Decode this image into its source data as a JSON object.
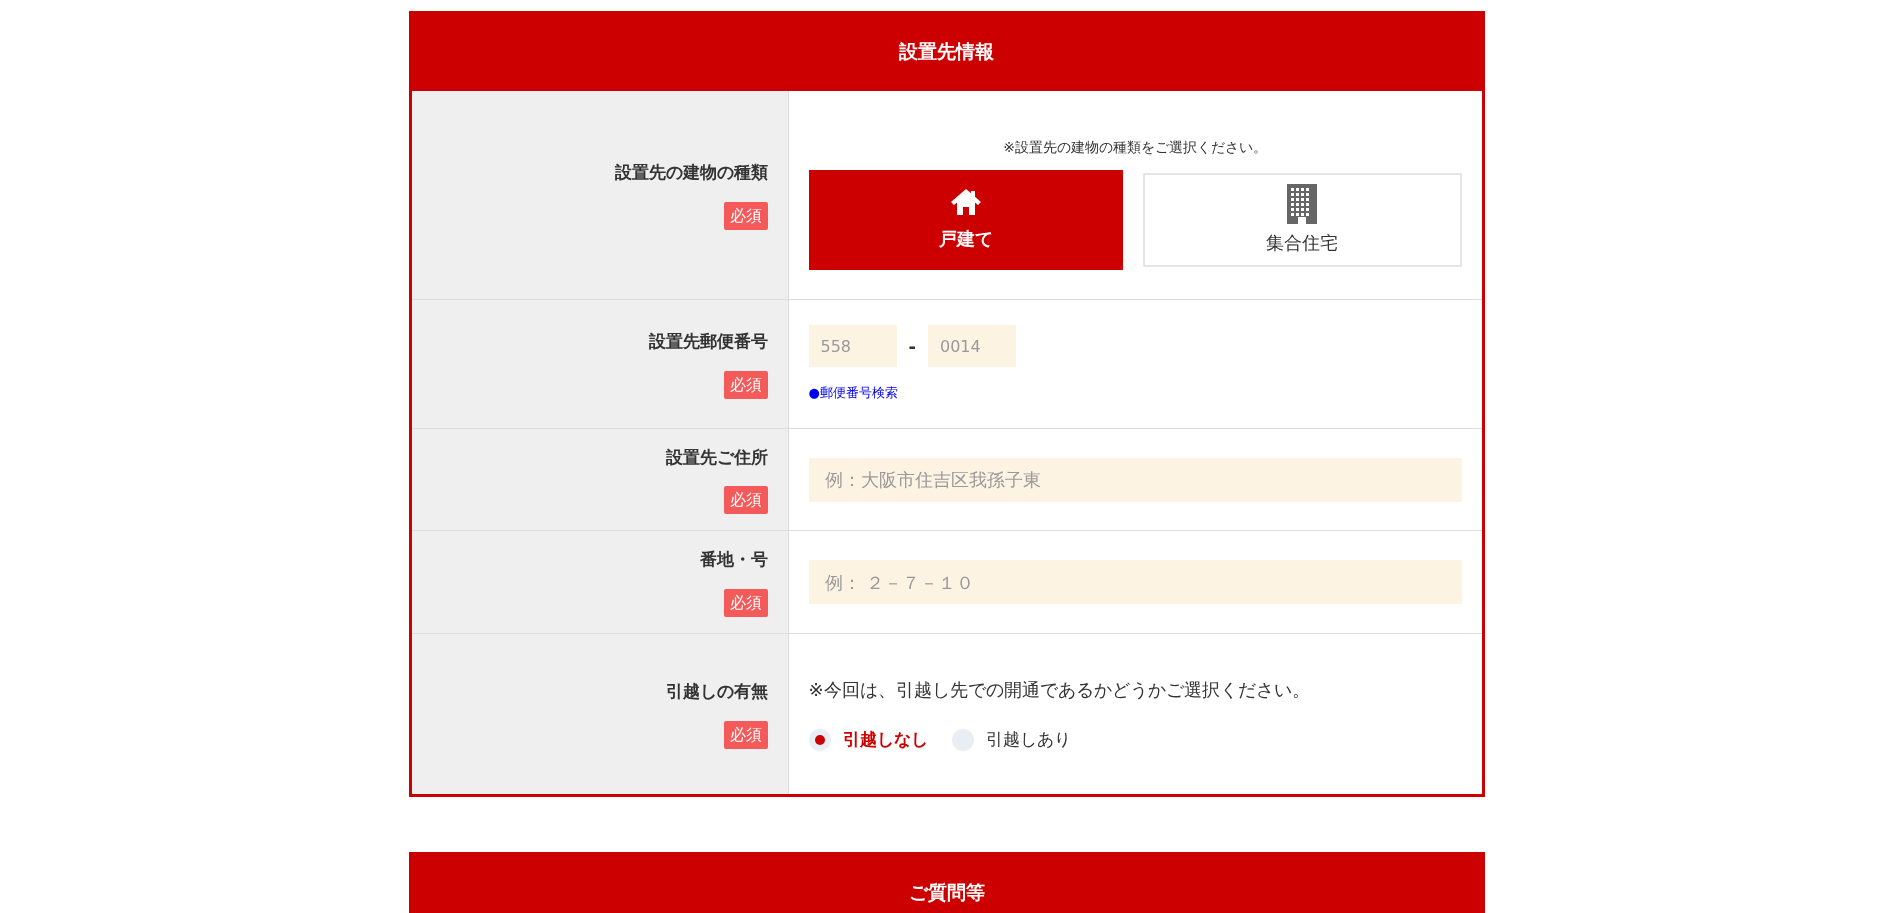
{
  "sections": [
    {
      "title": "設置先情報",
      "rows": [
        {
          "kind": "building",
          "label": "設置先の建物の種類",
          "badge": "必須",
          "note": "※設置先の建物の種類をご選択ください。",
          "options": [
            {
              "label": "戸建て",
              "kind": "house",
              "selected": true
            },
            {
              "label": "集合住宅",
              "kind": "apartment",
              "selected": false
            }
          ]
        },
        {
          "kind": "postal",
          "label": "設置先郵便番号",
          "badge": "必須",
          "first": {
            "placeholder": "558"
          },
          "separator": "-",
          "second": {
            "placeholder": "0014"
          },
          "link": "●郵便番号検索"
        },
        {
          "kind": "text",
          "label": "設置先ご住所",
          "badge": "必須",
          "field": {
            "placeholder": "例：大阪市住吉区我孫子東"
          }
        },
        {
          "kind": "text",
          "label": "番地・号",
          "badge": "必須",
          "field": {
            "placeholder": "例： ２－７－１０"
          }
        },
        {
          "kind": "radio",
          "label": "引越しの有無",
          "badge": "必須",
          "note": "※今回は、引越し先での開通であるかどうかご選択ください。",
          "options": [
            {
              "label": "引越しなし",
              "selected": true
            },
            {
              "label": "引越しあり",
              "selected": false
            }
          ]
        }
      ]
    },
    {
      "title": "ご質問等"
    }
  ]
}
